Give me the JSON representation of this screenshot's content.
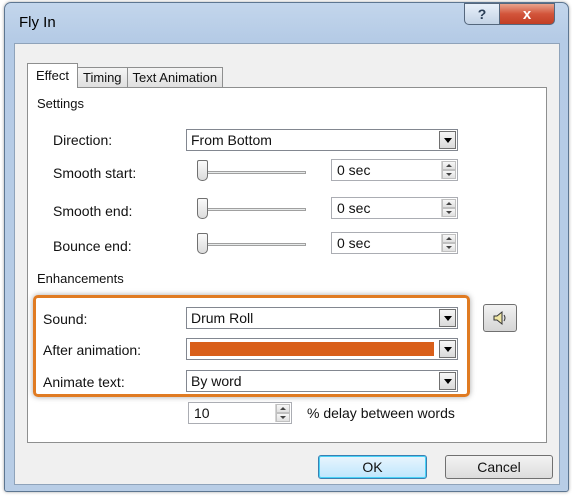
{
  "window": {
    "title": "Fly In",
    "help_glyph": "?",
    "close_glyph": "x"
  },
  "tabs": [
    {
      "label": "Effect",
      "active": true
    },
    {
      "label": "Timing",
      "active": false
    },
    {
      "label": "Text Animation",
      "active": false
    }
  ],
  "settings": {
    "group_label": "Settings",
    "direction": {
      "label": "Direction:",
      "value": "From Bottom"
    },
    "smooth_start": {
      "label": "Smooth start:",
      "value": "0 sec",
      "slider_level": 0
    },
    "smooth_end": {
      "label": "Smooth end:",
      "value": "0 sec",
      "slider_level": 0
    },
    "bounce_end": {
      "label": "Bounce end:",
      "value": "0 sec",
      "slider_level": 0
    }
  },
  "enhancements": {
    "group_label": "Enhancements",
    "sound": {
      "label": "Sound:",
      "value": "Drum Roll"
    },
    "after_animation": {
      "label": "After animation:",
      "value": "",
      "swatch_color": "#d95f1a"
    },
    "animate_text": {
      "label": "Animate text:",
      "value": "By word"
    },
    "delay": {
      "value": "10",
      "suffix": "% delay between words"
    }
  },
  "buttons": {
    "ok": "OK",
    "cancel": "Cancel"
  },
  "colors": {
    "highlight": "#e07b22",
    "title_bar": "#b9cfe8",
    "close_button": "#c9472d"
  }
}
